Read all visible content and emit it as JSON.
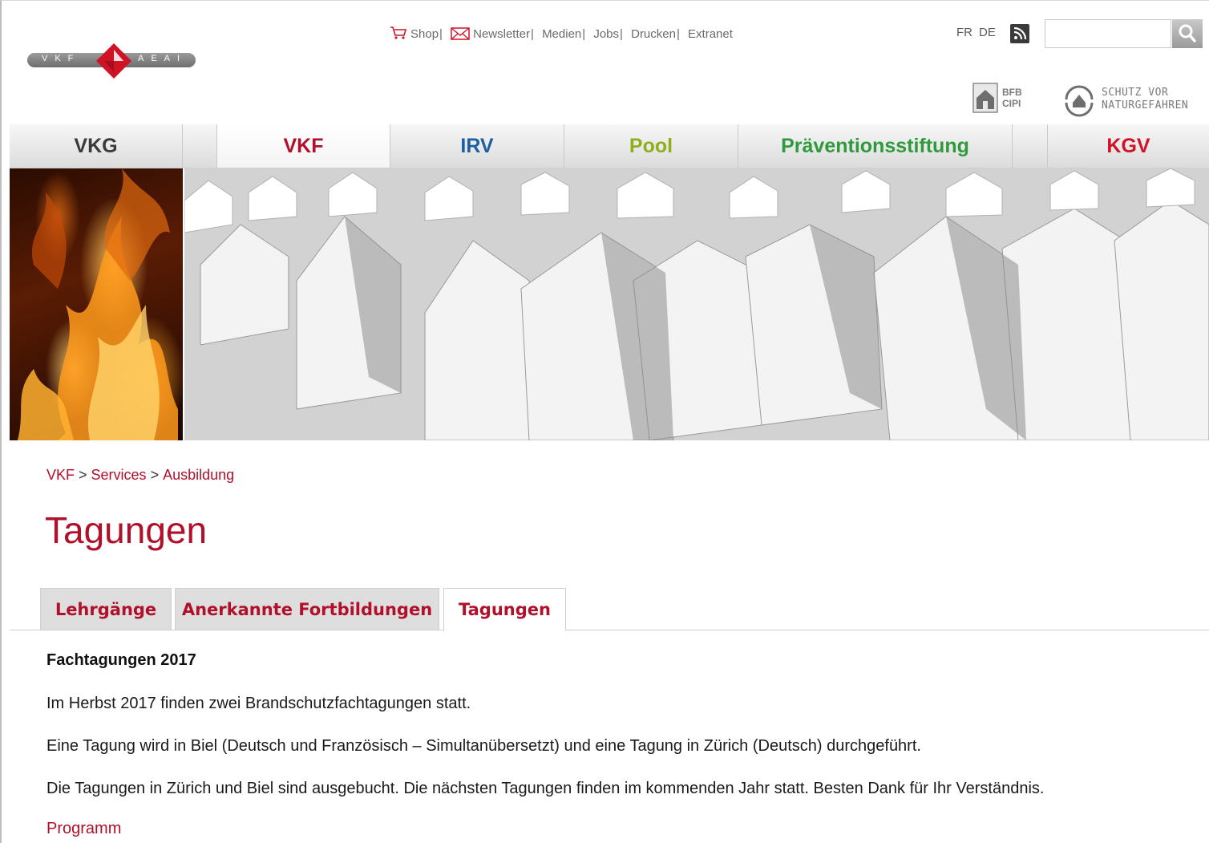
{
  "logo": {
    "left_letters": "VKF",
    "right_letters": "AEAI",
    "icon": "vkf-diamond-logo",
    "red": "#d01227",
    "grey": "#7a7a7a"
  },
  "toplinks": {
    "items": [
      {
        "label": "Shop",
        "icon": "shopping-cart-icon"
      },
      {
        "label": "Newsletter",
        "icon": "envelope-icon"
      },
      {
        "label": "Medien"
      },
      {
        "label": "Jobs"
      },
      {
        "label": "Drucken"
      },
      {
        "label": "Extranet"
      }
    ],
    "separator": "|"
  },
  "languages": [
    "FR",
    "DE"
  ],
  "rss_icon": "rss-icon",
  "search": {
    "value": "",
    "placeholder": "",
    "icon": "magnifier-icon"
  },
  "partner_logos": {
    "bfb": {
      "line1": "BFB",
      "line2": "CIPI",
      "icon": "house-shield-icon"
    },
    "schutz": {
      "line1": "SCHUTZ VOR",
      "line2": "NATURGEFAHREN",
      "icon": "house-circle-icon"
    }
  },
  "mainnav": {
    "items": [
      {
        "label": "VKG",
        "color": "#3a3a3a",
        "active": false
      },
      {
        "label": "VKF",
        "color": "#b0102a",
        "active": true
      },
      {
        "label": "IRV",
        "color": "#1e5fa0",
        "active": false
      },
      {
        "label": "Pool",
        "color": "#8fae1b",
        "active": false
      },
      {
        "label": "Präventionsstiftung",
        "color": "#2f9a3c",
        "active": false
      },
      {
        "label": "KGV",
        "color": "#d01227",
        "active": false
      }
    ]
  },
  "breadcrumb": {
    "items": [
      "VKF",
      "Services",
      "Ausbildung"
    ],
    "separator": ">"
  },
  "page": {
    "title": "Tagungen"
  },
  "tabs": {
    "items": [
      {
        "label": "Lehrgänge",
        "active": false
      },
      {
        "label": "Anerkannte Fortbildungen",
        "active": false
      },
      {
        "label": "Tagungen",
        "active": true
      }
    ]
  },
  "content": {
    "heading": "Fachtagungen 2017",
    "paragraphs": [
      "Im Herbst 2017 finden zwei Brandschutzfachtagungen statt.",
      "Eine Tagung wird in Biel (Deutsch und Französisch – Simultanübersetzt) und eine Tagung in Zürich (Deutsch) durchgeführt.",
      "Die Tagungen in Zürich und Biel sind ausgebucht. Die nächsten Tagungen finden im kommenden Jahr statt. Besten Dank für Ihr Verständnis."
    ],
    "link": "Programm"
  },
  "colors": {
    "accent": "#b0102a",
    "text": "#1a1a1a",
    "muted": "#6b6b6b"
  }
}
